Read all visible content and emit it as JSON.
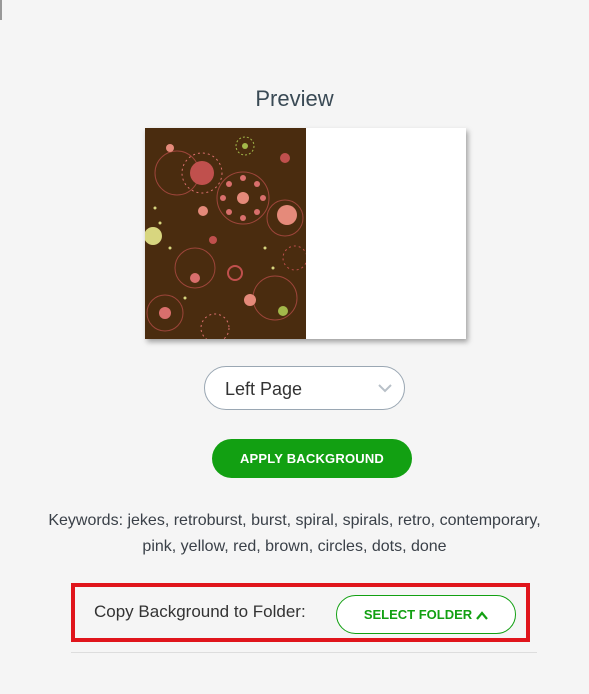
{
  "preview": {
    "title": "Preview",
    "background_colors": {
      "base": "#4a2c0f",
      "red": "#c0504d",
      "salmon": "#e58a7a",
      "pink": "#d96f6c",
      "yellow": "#d8d67f",
      "green": "#a3b84a"
    }
  },
  "page_select": {
    "value": "Left Page",
    "icon": "chevron-down-icon"
  },
  "apply_button": {
    "label": "APPLY BACKGROUND"
  },
  "keywords": {
    "line1": "Keywords: jekes, retroburst, burst, spiral, spirals, retro, contemporary,",
    "line2": "pink, yellow, red, brown, circles, dots, done"
  },
  "copy_folder": {
    "label": "Copy Background to Folder:",
    "button_label": "SELECT FOLDER",
    "button_icon": "chevron-up-icon",
    "highlight_color": "#e0151c"
  },
  "colors": {
    "accent": "#12a012",
    "border": "#9aa7b3"
  }
}
